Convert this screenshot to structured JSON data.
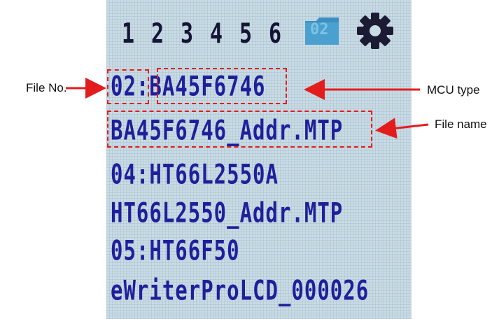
{
  "screen": {
    "tabs": [
      "1",
      "2",
      "3",
      "4",
      "5",
      "6"
    ],
    "active_folder_label": "02",
    "settings_icon": "gear-icon",
    "folder_icon": "folder-icon",
    "rows": [
      "02:BA45F6746",
      "BA45F6746_Addr.MTP",
      "04:HT66L2550A",
      "HT66L2550_Addr.MTP",
      "05:HT66F50",
      "eWriterProLCD_000026"
    ]
  },
  "annotations": {
    "file_no": "File No.",
    "mcu_type": "MCU type",
    "file_name": "File name",
    "color": "#e31d1d"
  }
}
